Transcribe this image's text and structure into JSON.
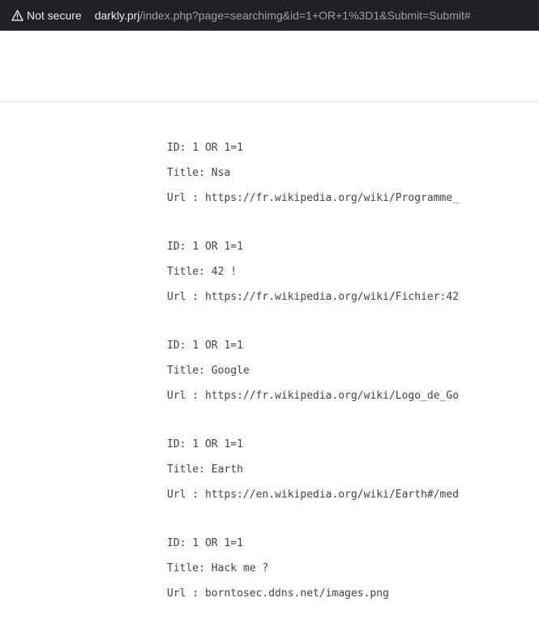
{
  "browser": {
    "security_label": "Not secure",
    "url_host": "darkly.prj",
    "url_path": "/index.php?page=searchimg&id=1+OR+1%3D1&Submit=Submit#"
  },
  "results": [
    {
      "id_label": "ID:",
      "id_value": "1 OR 1=1",
      "title_label": "Title:",
      "title_value": "Nsa",
      "url_label": "Url :",
      "url_value": "https://fr.wikipedia.org/wiki/Programme_"
    },
    {
      "id_label": "ID:",
      "id_value": "1 OR 1=1",
      "title_label": "Title:",
      "title_value": "42 !",
      "url_label": "Url :",
      "url_value": "https://fr.wikipedia.org/wiki/Fichier:42"
    },
    {
      "id_label": "ID:",
      "id_value": "1 OR 1=1",
      "title_label": "Title:",
      "title_value": "Google",
      "url_label": "Url :",
      "url_value": "https://fr.wikipedia.org/wiki/Logo_de_Go"
    },
    {
      "id_label": "ID:",
      "id_value": "1 OR 1=1",
      "title_label": "Title:",
      "title_value": "Earth",
      "url_label": "Url :",
      "url_value": "https://en.wikipedia.org/wiki/Earth#/med"
    },
    {
      "id_label": "ID:",
      "id_value": "1 OR 1=1",
      "title_label": "Title:",
      "title_value": "Hack me ?",
      "url_label": "Url :",
      "url_value": "borntosec.ddns.net/images.png"
    }
  ]
}
